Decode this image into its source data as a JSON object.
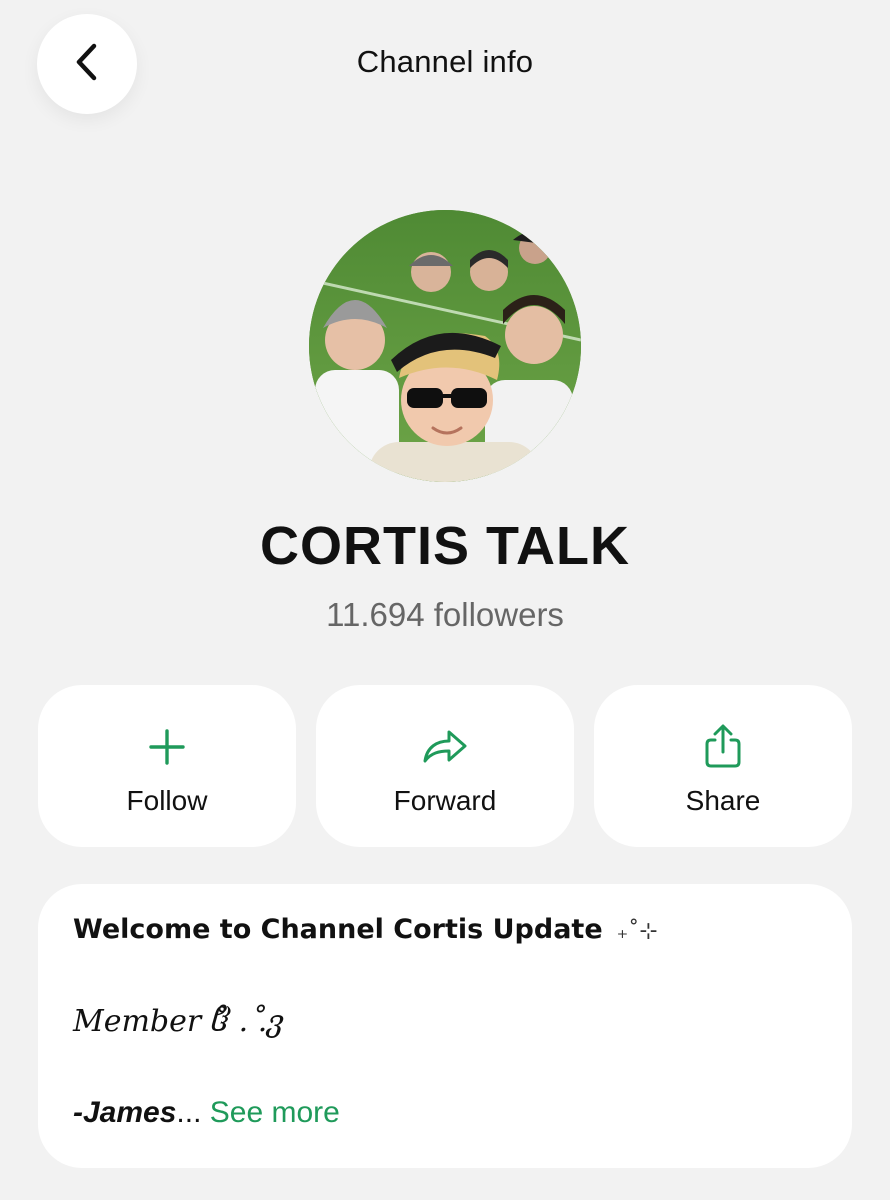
{
  "header": {
    "title": "Channel info"
  },
  "channel": {
    "name": "CORTIS TALK",
    "followers": "11.694 followers"
  },
  "actions": [
    {
      "label": "Follow",
      "icon": "plus-icon"
    },
    {
      "label": "Forward",
      "icon": "forward-arrow-icon"
    },
    {
      "label": "Share",
      "icon": "share-icon"
    }
  ],
  "description": {
    "line1": "Welcome to Channel Cortis Update",
    "line1_decoration": "₊˚⊹",
    "line2": "Member ჱ̊ . .̊ვ",
    "author": "-James",
    "ellipsis": "...",
    "see_more": "See more"
  },
  "colors": {
    "background": "#f2f2f2",
    "card": "#ffffff",
    "accent_green": "#1f9a5a",
    "muted_text": "#666666"
  }
}
